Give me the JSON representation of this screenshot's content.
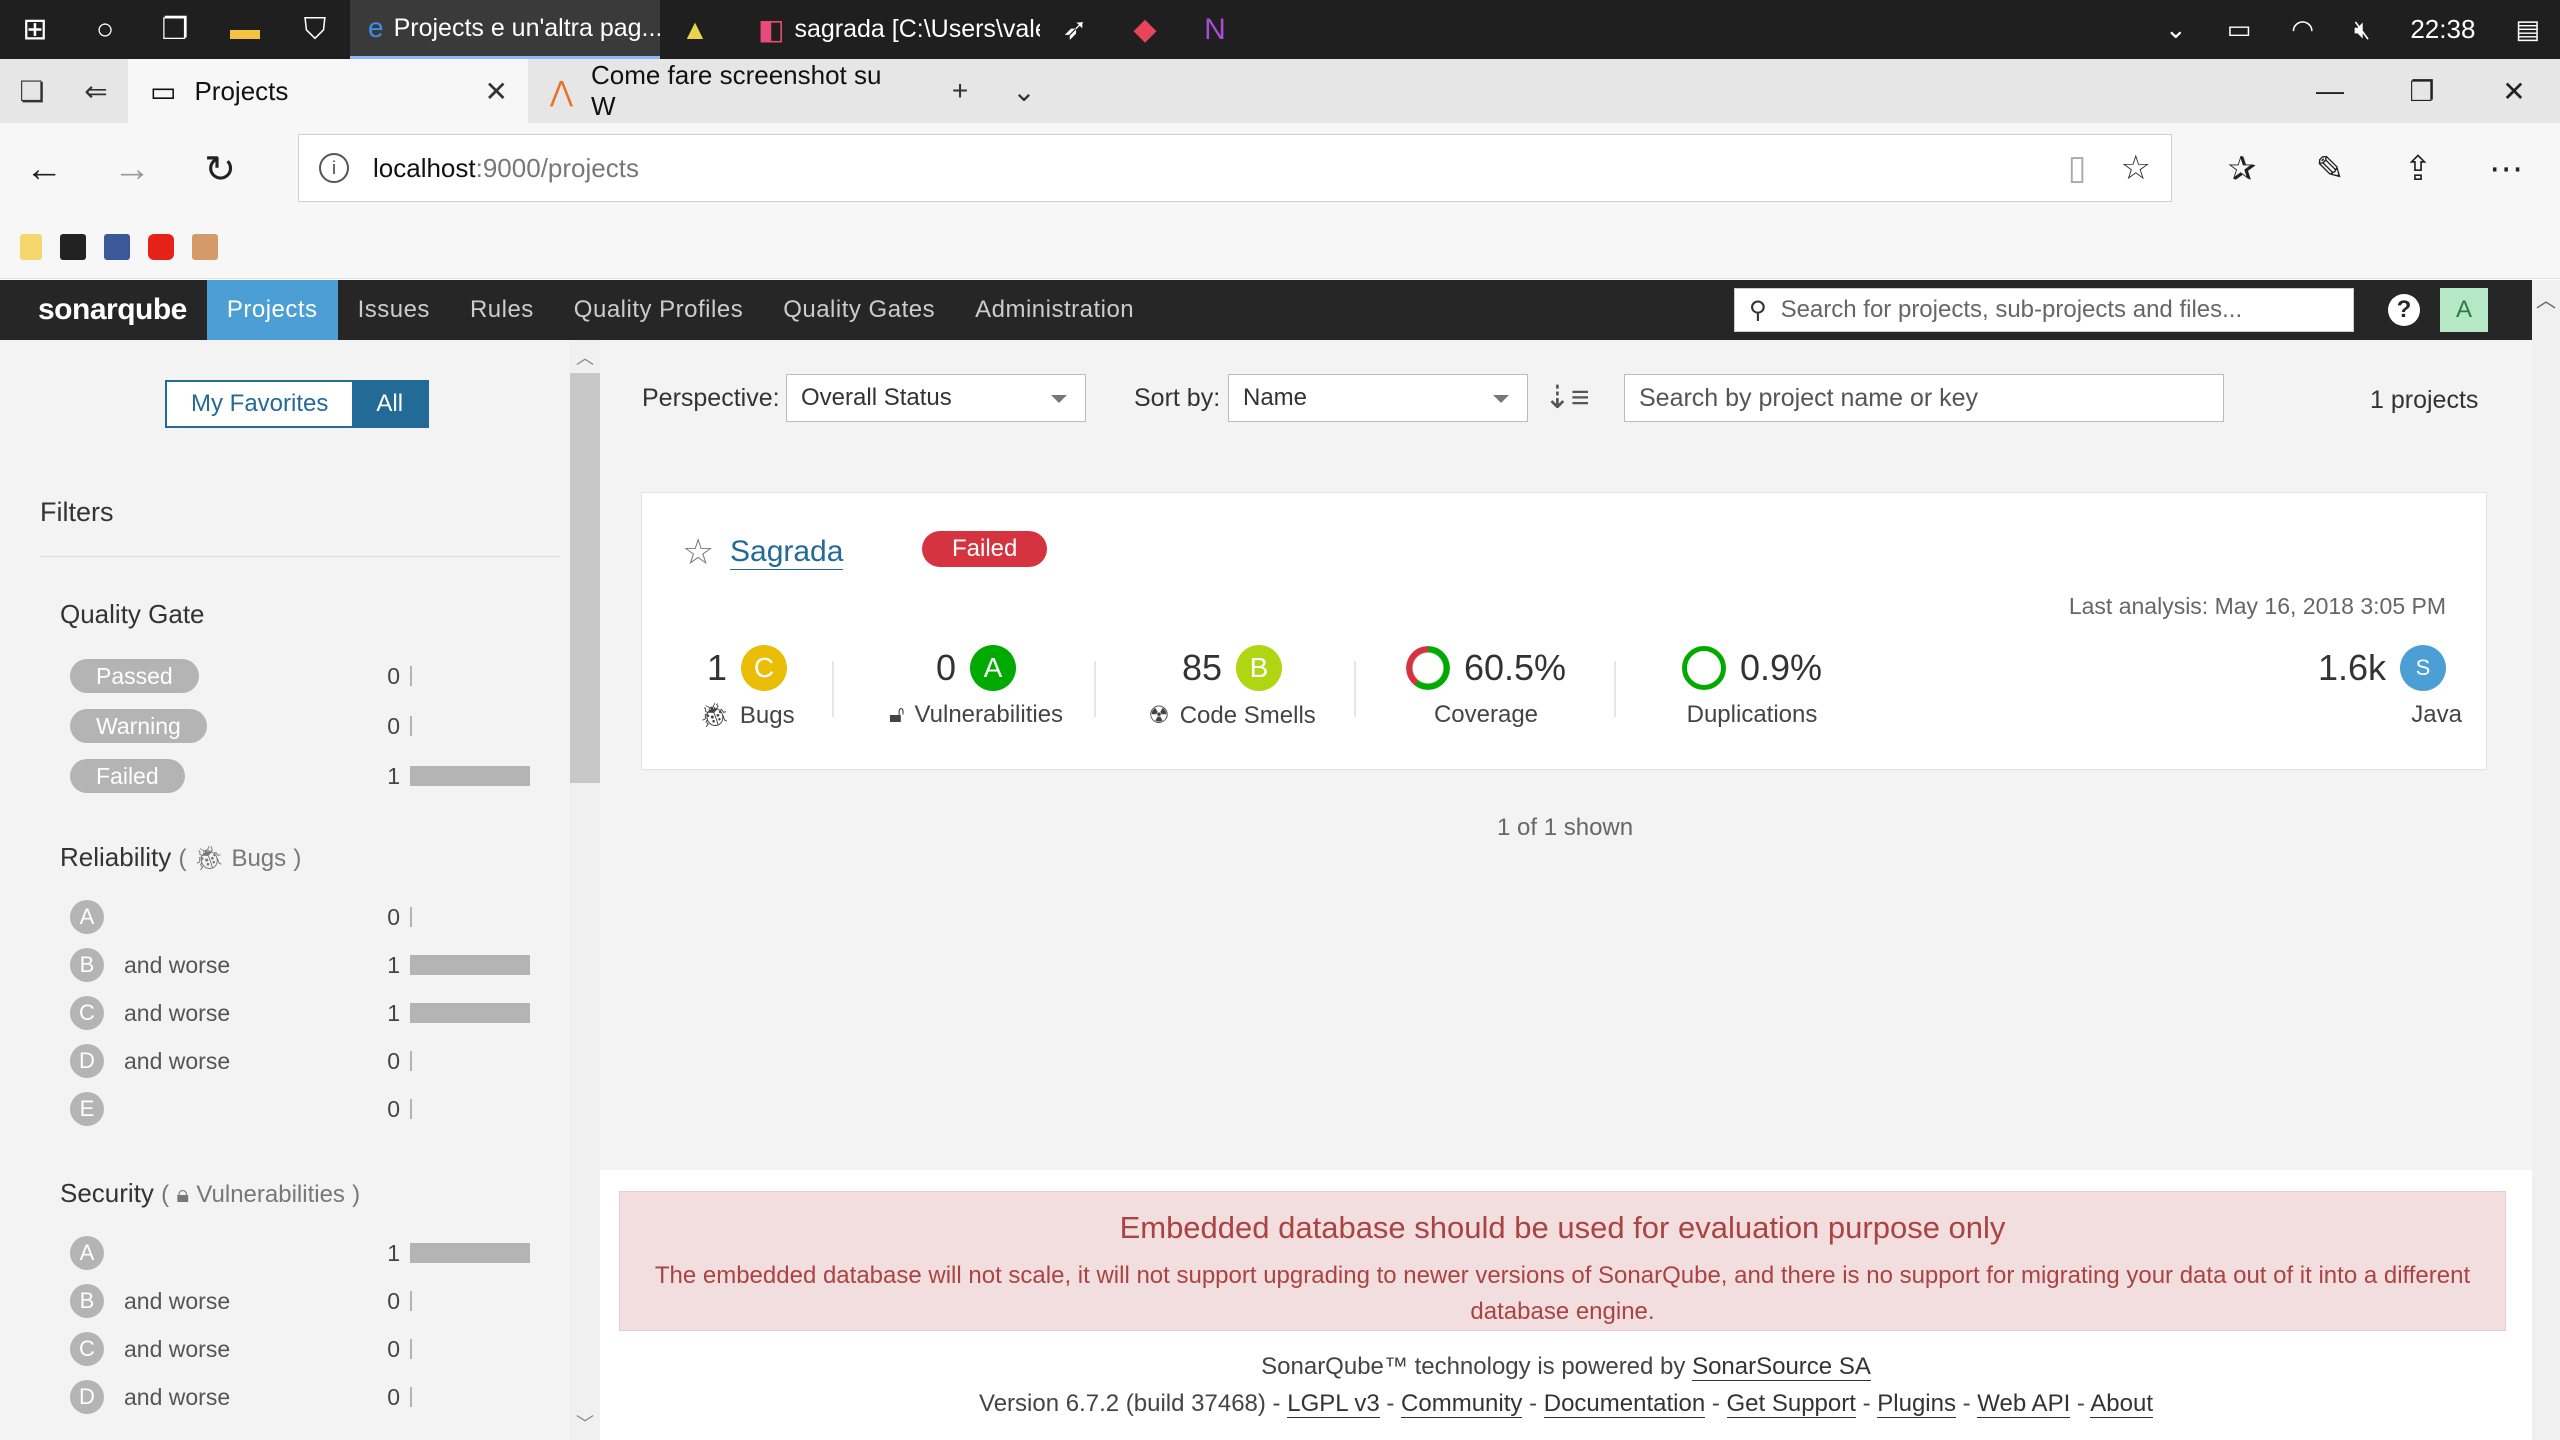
{
  "taskbar": {
    "apps": [
      {
        "label": "Projects e un'altra pag...",
        "icon": "edge-icon"
      },
      {
        "label": "",
        "icon": "app-icon"
      },
      {
        "label": "sagrada [C:\\Users\\vale...",
        "icon": "intellij-icon"
      }
    ],
    "time": "22:38"
  },
  "tabs": [
    {
      "title": "Projects"
    },
    {
      "title": "Come fare screenshot su W"
    }
  ],
  "address": {
    "host": "localhost",
    "path": ":9000/projects"
  },
  "sonar": {
    "logo": "sonarqube",
    "menu": [
      "Projects",
      "Issues",
      "Rules",
      "Quality Profiles",
      "Quality Gates",
      "Administration"
    ],
    "search_placeholder": "Search for projects, sub-projects and files...",
    "avatar": "A"
  },
  "sidebar": {
    "toggle": [
      "My Favorites",
      "All"
    ],
    "filters_title": "Filters",
    "quality_gate": {
      "title": "Quality Gate",
      "items": [
        {
          "label": "Passed",
          "count": "0",
          "fraction": 0
        },
        {
          "label": "Warning",
          "count": "0",
          "fraction": 0
        },
        {
          "label": "Failed",
          "count": "1",
          "fraction": 1
        }
      ]
    },
    "reliability": {
      "title": "Reliability",
      "paren_open": "(",
      "sub": "Bugs",
      "paren_close": ")",
      "items": [
        {
          "rating": "A",
          "label": "",
          "count": "0",
          "fraction": 0
        },
        {
          "rating": "B",
          "label": "and worse",
          "count": "1",
          "fraction": 1
        },
        {
          "rating": "C",
          "label": "and worse",
          "count": "1",
          "fraction": 1
        },
        {
          "rating": "D",
          "label": "and worse",
          "count": "0",
          "fraction": 0
        },
        {
          "rating": "E",
          "label": "",
          "count": "0",
          "fraction": 0
        }
      ]
    },
    "security": {
      "title": "Security",
      "paren_open": "(",
      "sub": "Vulnerabilities",
      "paren_close": ")",
      "items": [
        {
          "rating": "A",
          "label": "",
          "count": "1",
          "fraction": 1
        },
        {
          "rating": "B",
          "label": "and worse",
          "count": "0",
          "fraction": 0
        },
        {
          "rating": "C",
          "label": "and worse",
          "count": "0",
          "fraction": 0
        },
        {
          "rating": "D",
          "label": "and worse",
          "count": "0",
          "fraction": 0
        }
      ]
    }
  },
  "toolbar": {
    "perspective_label": "Perspective:",
    "perspective_value": "Overall Status",
    "sort_label": "Sort by:",
    "sort_value": "Name",
    "search_placeholder": "Search by project name or key",
    "count": "1 projects"
  },
  "project": {
    "name": "Sagrada",
    "gate": "Failed",
    "last_analysis": "Last analysis: May 16, 2018 3:05 PM",
    "bugs": {
      "value": "1",
      "rating": "C",
      "label": "Bugs"
    },
    "vulnerabilities": {
      "value": "0",
      "rating": "A",
      "label": "Vulnerabilities"
    },
    "code_smells": {
      "value": "85",
      "rating": "B",
      "label": "Code Smells"
    },
    "coverage": {
      "value": "60.5%",
      "label": "Coverage",
      "percent": 60.5
    },
    "duplications": {
      "value": "0.9%",
      "label": "Duplications"
    },
    "size": {
      "value": "1.6k",
      "badge": "S",
      "label": "Java"
    }
  },
  "shown": "1 of 1 shown",
  "warning": {
    "title": "Embedded database should be used for evaluation purpose only",
    "body": "The embedded database will not scale, it will not support upgrading to newer versions of SonarQube, and there is no support for migrating your data out of it into a different database engine."
  },
  "footer": {
    "powered_prefix": "SonarQube™ technology is powered by ",
    "powered_link": "SonarSource SA",
    "version": "Version 6.7.2 (build 37468)",
    "links": [
      "LGPL v3",
      "Community",
      "Documentation",
      "Get Support",
      "Plugins",
      "Web API",
      "About"
    ]
  },
  "colors": {
    "rating_A": "#00aa00",
    "rating_B": "#b0d513",
    "rating_C": "#eabe06",
    "failed": "#d4333f",
    "link": "#236a97",
    "nav_active": "#4b9fd5",
    "size_badge": "#4b9fd5"
  }
}
